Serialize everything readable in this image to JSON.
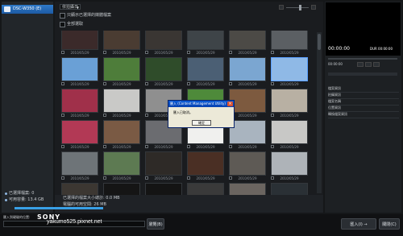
{
  "left_panel": {
    "device_label": "DSC-W350 (E)",
    "info_1": "已選擇檔案: 0",
    "info_2": "可用容量: 13.4 GB"
  },
  "toolbar": {
    "sort_label": "依拍攝日",
    "option_1": "只顯示已選擇的媒體檔案",
    "option_2": "全部選取"
  },
  "grid": {
    "rows": [
      [
        "2010/05/29",
        "2010/05/29",
        "2010/05/29",
        "2010/05/29",
        "2010/05/29",
        "2010/05/29"
      ],
      [
        "2010/05/29",
        "2010/05/29",
        "2010/05/29",
        "2010/05/29",
        "2010/05/29",
        "2010/05/29"
      ],
      [
        "2010/05/29",
        "2010/05/29",
        "2010/05/29",
        "2010/05/29",
        "2010/05/29",
        "2010/05/29"
      ],
      [
        "2010/05/29",
        "2010/05/29",
        "2010/05/29",
        "2010/05/29",
        "2010/05/29",
        "2010/05/29"
      ],
      [
        "2010/05/29",
        "2010/05/29",
        "2010/05/29",
        "2010/05/29",
        "2010/05/29",
        "2010/05/29"
      ],
      [
        "",
        "",
        "",
        "",
        "",
        ""
      ]
    ],
    "colors": [
      [
        "#3b2a2a",
        "#4a3c32",
        "#3a3633",
        "#3e4448",
        "#4c4a46",
        "#5b5f63"
      ],
      [
        "#6aa0d6",
        "#4e7d3a",
        "#2f4c2a",
        "#4b5f74",
        "#7ba6d1",
        "#8fb9e6"
      ],
      [
        "#a0304a",
        "#c9c9c7",
        "#8f8f8f",
        "#4e8a3a",
        "#7d5a3f",
        "#b8b0a3"
      ],
      [
        "#b23955",
        "#7a5a44",
        "#6b6c70",
        "#f0f0ee",
        "#a9b4bf",
        "#c8c8c6"
      ],
      [
        "#6e7478",
        "#5d7a52",
        "#2e2a27",
        "#4a2f24",
        "#5e5a55",
        "#aeb3b8"
      ],
      [
        "#3c3732",
        "#151515",
        "#141414",
        "#3a3a3a",
        "#6b6560",
        "#2a3035"
      ]
    ]
  },
  "bottom_bar": {
    "line_1": "已選擇的檔案大小總計: 0.0 MB",
    "line_2": "電腦的可用空間: 26 MB"
  },
  "preview": {
    "time_left": "00:00:00",
    "time_right": "DUR 00:00:00",
    "time_mid": "00:00:00"
  },
  "right_list": {
    "items": [
      "檔案資訊",
      "拍攝資訊",
      "檔案名稱",
      "位置資訊",
      "轉換檔案資訊"
    ]
  },
  "dialog": {
    "title": "匯入 (Content Management Utility)",
    "message": "匯入已取消。",
    "ok_label": "確定"
  },
  "footer": {
    "search_placeholder": "",
    "watermark": "yakumo525.pixnet.net",
    "sony_logo": "SONY",
    "search_button": "瀏覽(B)",
    "import_button": "匯入(I) →",
    "close_button": "關閉(C)",
    "path_label": "匯入到硬碟的位置:"
  },
  "accent_colors": {
    "selection": "#2f79c8",
    "selected_border": "#5aa0ff"
  }
}
